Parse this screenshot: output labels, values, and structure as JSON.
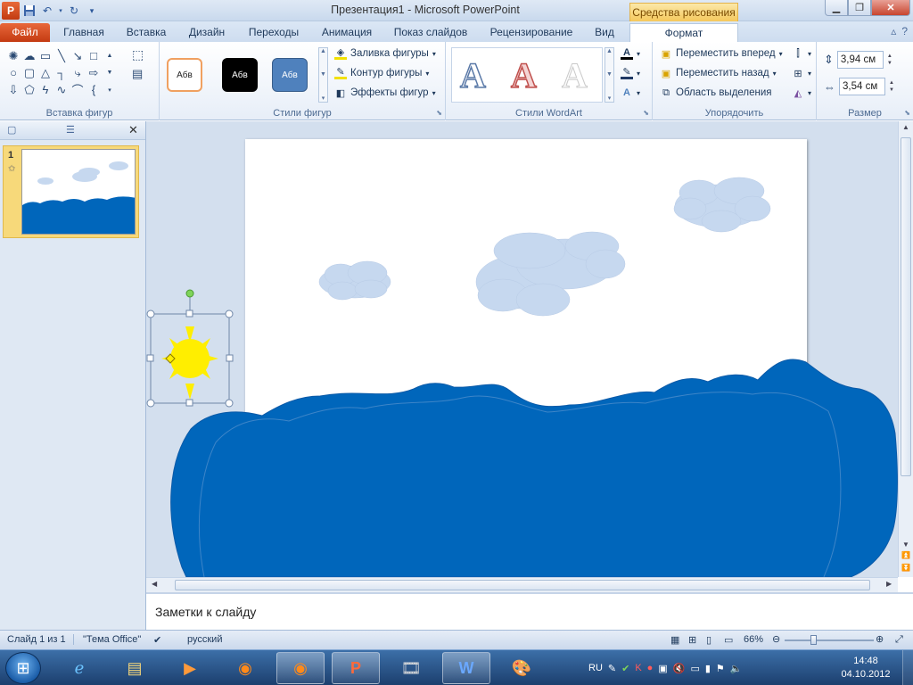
{
  "titlebar": {
    "title": "Презентация1  -  Microsoft PowerPoint",
    "context_tab": "Средства рисования",
    "app_logo": "P",
    "qat_icons": [
      "save-icon",
      "undo-icon",
      "redo-icon",
      "customize-qat-icon"
    ]
  },
  "tabs": {
    "file": "Файл",
    "home": "Главная",
    "insert": "Вставка",
    "design": "Дизайн",
    "transitions": "Переходы",
    "animations": "Анимация",
    "slideshow": "Показ слайдов",
    "review": "Рецензирование",
    "view": "Вид",
    "format": "Формат"
  },
  "ribbon": {
    "insert_shapes_label": "Вставка фигур",
    "shape_styles_label": "Стили фигур",
    "wordart_styles_label": "Стили WordArt",
    "arrange_label": "Упорядочить",
    "size_label": "Размер",
    "style_swatch_text": "Абв",
    "shape_fill": "Заливка фигуры",
    "shape_outline": "Контур фигуры",
    "shape_effects": "Эффекты фигур",
    "bring_forward": "Переместить вперед",
    "send_backward": "Переместить назад",
    "selection_pane": "Область выделения",
    "wordart_letter": "A",
    "height_value": "3,94 см",
    "width_value": "3,54 см"
  },
  "slide_panel": {
    "slide_number": "1"
  },
  "notes": {
    "placeholder": "Заметки к слайду"
  },
  "status": {
    "slide_info": "Слайд 1 из 1",
    "theme": "\"Тема Office\"",
    "language": "русский",
    "zoom": "66%"
  },
  "taskbar": {
    "language": "RU",
    "time": "14:48",
    "date": "04.10.2012"
  },
  "colors": {
    "sea": "#0066bb",
    "cloud": "#c6d8ef",
    "sun": "#ffee00",
    "file_tab": "#d9531e",
    "context_tab": "#f5c85c"
  }
}
